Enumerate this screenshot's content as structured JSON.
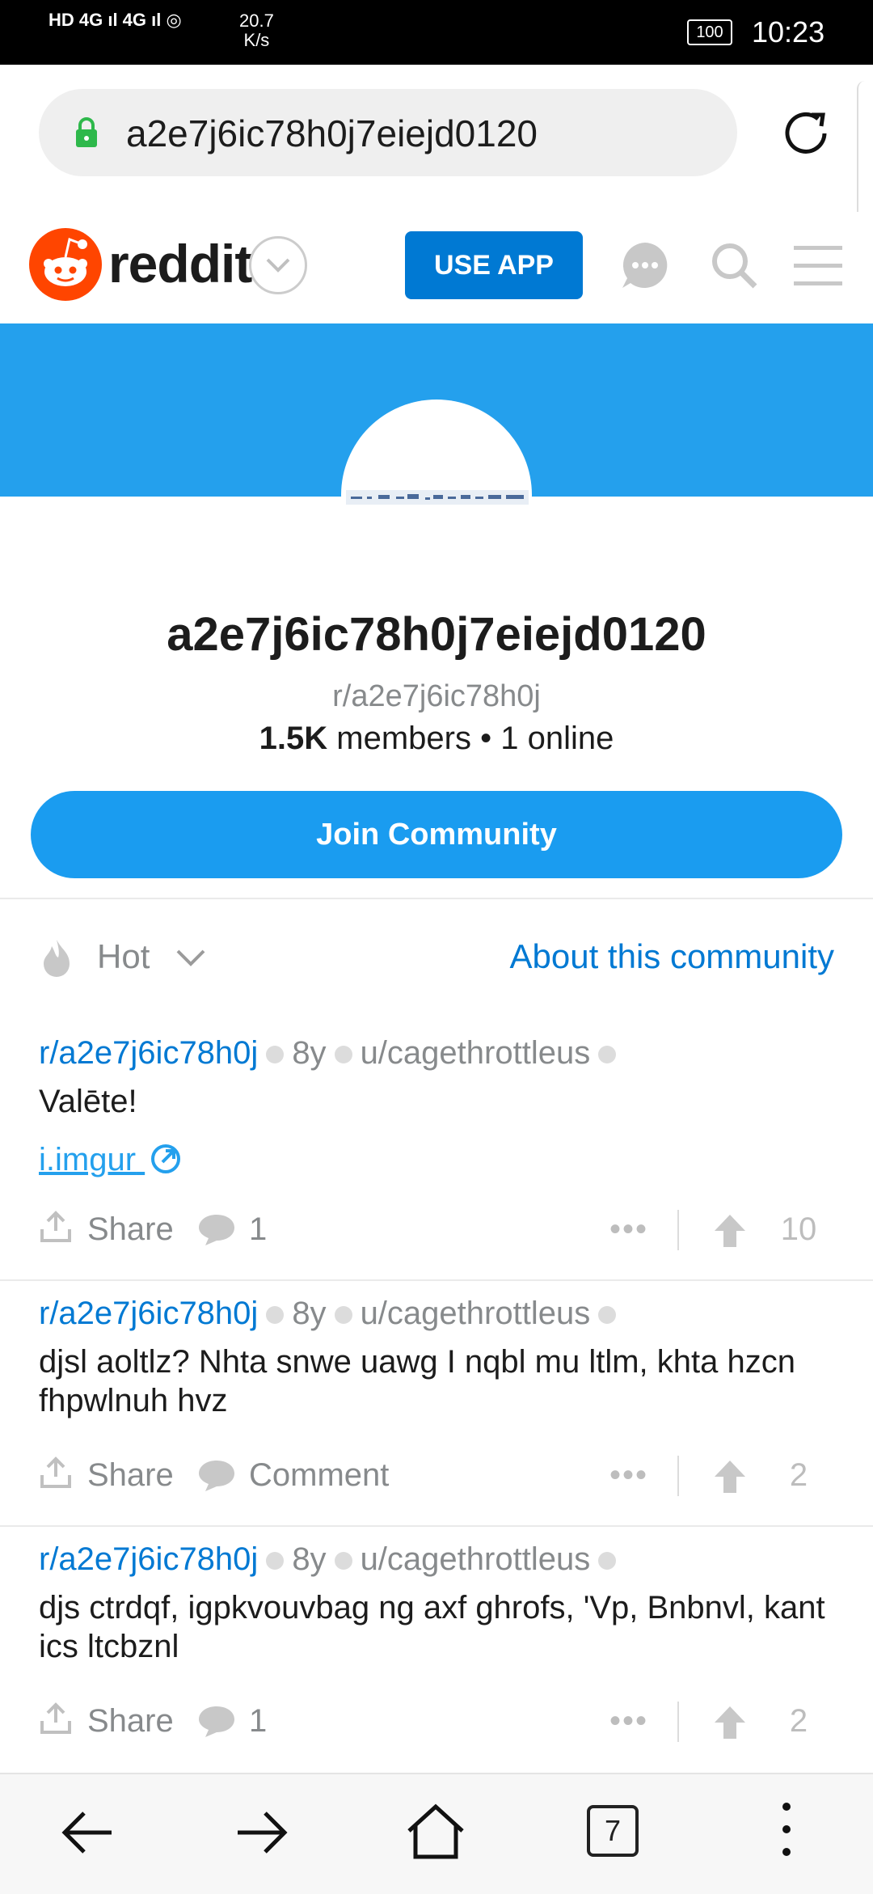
{
  "status_bar": {
    "net_speed": "20.7\nK/s",
    "time": "10:23",
    "battery": "100"
  },
  "browser": {
    "url": "a2e7j6ic78h0j7eiejd0120",
    "tab_count": "7"
  },
  "header": {
    "brand": "reddit",
    "use_app_label": "USE APP"
  },
  "community": {
    "title": "a2e7j6ic78h0j7eiejd0120",
    "handle": "r/a2e7j6ic78h0j",
    "members": "1.5K",
    "members_label": "members",
    "online": "• 1 online",
    "join_label": "Join Community"
  },
  "sort": {
    "label": "Hot",
    "about_label": "About this community"
  },
  "posts": [
    {
      "subreddit": "r/a2e7j6ic78h0j",
      "age": "8y",
      "author": "u/cagethrottleus",
      "title": "Valēte!",
      "link": "i.imgur",
      "share": "Share",
      "comments": "1",
      "score": "10"
    },
    {
      "subreddit": "r/a2e7j6ic78h0j",
      "age": "8y",
      "author": "u/cagethrottleus",
      "title": "djsl aoltlz? Nhta snwe uawg I nqbl mu ltlm, khta hzcn fhpwlnuh hvz",
      "share": "Share",
      "comments": "Comment",
      "score": "2"
    },
    {
      "subreddit": "r/a2e7j6ic78h0j",
      "age": "8y",
      "author": "u/cagethrottleus",
      "title": "djs ctrdqf, igpkvouvbag ng axf ghrofs, 'Vp, Bnbnvl, kant ics ltcbznl",
      "share": "Share",
      "comments": "1",
      "score": "2"
    }
  ],
  "colors": {
    "brand_orange": "#ff4500",
    "primary_blue": "#0079d3",
    "banner_blue": "#24a0ed"
  },
  "icons": [
    "lock-icon",
    "reload-icon",
    "chat-icon",
    "search-icon",
    "menu-icon",
    "flame-icon",
    "share-icon",
    "comment-icon",
    "upvote-icon",
    "back-icon",
    "forward-icon",
    "home-icon",
    "more-vert-icon"
  ]
}
